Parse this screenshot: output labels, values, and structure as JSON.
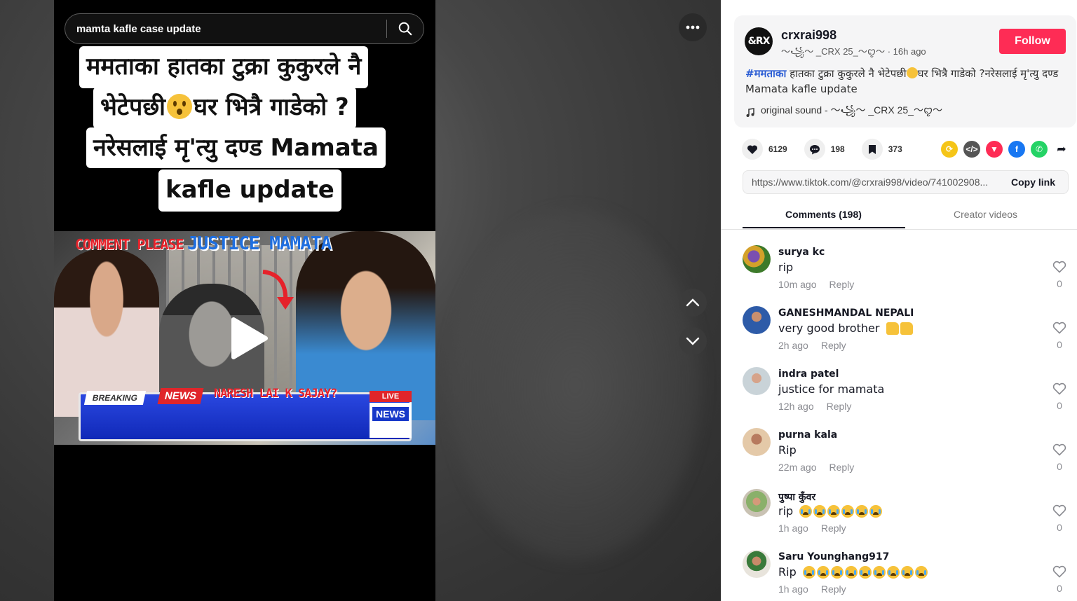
{
  "search": {
    "query": "mamta kafle case update"
  },
  "video": {
    "captions": [
      "ममताका हातका टुक्रा कुकुरले नै",
      "भेटेपछी",
      "घर भित्रै गाडेको ?",
      "नरेसलाई मृ'त्यु दण्ड Mamata",
      "kafle update"
    ],
    "thumbnail": {
      "comment_text": "COMMENT PLEASE",
      "justice_text": "JUSTICE MAMATA",
      "breaking": "BREAKING",
      "news": "NEWS",
      "naresh": "NARESH LAI K SAJAY?",
      "live": "LIVE",
      "news_box": "NEWS"
    }
  },
  "author": {
    "avatar_text": "&RX",
    "username": "crxrai998",
    "display": "〜꧁〜 _CRX 25_〜ꨄ〜",
    "time": "16h ago",
    "follow_label": "Follow"
  },
  "description": {
    "hashtag": "#ममताका",
    "text1": " हातका टुक्रा कुकुरले नै भेटेपछी",
    "text2": "घर भित्रै गाडेको ?नरेसलाई मृ'त्यु दण्ड Mamata kafle update"
  },
  "sound": {
    "label": "original sound - 〜꧁〜 _CRX 25_〜ꨄ〜"
  },
  "stats": {
    "likes": "6129",
    "comments": "198",
    "saves": "373"
  },
  "link": {
    "url": "https://www.tiktok.com/@crxrai998/video/741002908...",
    "copy_label": "Copy link"
  },
  "tabs": {
    "comments": "Comments (198)",
    "creator": "Creator videos"
  },
  "comments": [
    {
      "user": "surya kc",
      "text": "rip",
      "time": "10m ago",
      "reply": "Reply",
      "likes": "0"
    },
    {
      "user": "GANESHMANDAL NEPALI",
      "text": "very good brother",
      "time": "2h ago",
      "reply": "Reply",
      "likes": "0"
    },
    {
      "user": "indra patel",
      "text": "justice for mamata",
      "time": "12h ago",
      "reply": "Reply",
      "likes": "0"
    },
    {
      "user": "purna kala",
      "text": "Rip",
      "time": "22m ago",
      "reply": "Reply",
      "likes": "0"
    },
    {
      "user": "पुष्पा कुँवर",
      "text": "rip",
      "time": "1h ago",
      "reply": "Reply",
      "likes": "0"
    },
    {
      "user": "Saru Younghang917",
      "text": "Rip",
      "time": "1h ago",
      "reply": "Reply",
      "likes": "0"
    }
  ],
  "colors": {
    "follow": "#fe2c55",
    "hashtag": "#2b5dd4",
    "accent_text": "#161823"
  }
}
